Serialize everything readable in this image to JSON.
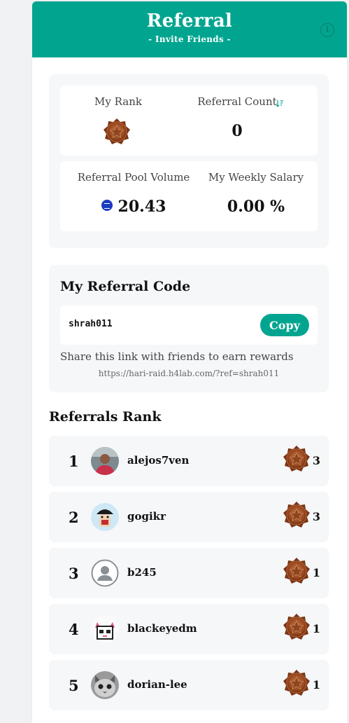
{
  "header": {
    "title": "Referral",
    "subtitle": "- Invite Friends -",
    "info_icon": "info-circle-icon",
    "color": "#01a58f"
  },
  "stats": {
    "my_rank_label": "My Rank",
    "my_rank_icon": "bronze-medal-icon",
    "referral_count_label": "Referral Count",
    "referral_count_icon": "sort-icon",
    "referral_count_value": "0",
    "pool_volume_label": "Referral Pool Volume",
    "pool_volume_icon": "steem-coin-icon",
    "pool_volume_value": "20.43",
    "weekly_salary_label": "My Weekly Salary",
    "weekly_salary_value": "0.00 %"
  },
  "referral_code": {
    "title": "My Referral Code",
    "code": "shrah011",
    "copy_label": "Copy",
    "share_text": "Share this link with friends to earn rewards",
    "share_link": "https://hari-raid.h4lab.com/?ref=shrah011"
  },
  "ranks": {
    "title": "Referrals Rank",
    "rows": [
      {
        "rank": "1",
        "name": "alejos7ven",
        "count": "3"
      },
      {
        "rank": "2",
        "name": "gogikr",
        "count": "3"
      },
      {
        "rank": "3",
        "name": "b245",
        "count": "1"
      },
      {
        "rank": "4",
        "name": "blackeyedm",
        "count": "1"
      },
      {
        "rank": "5",
        "name": "dorian-lee",
        "count": "1"
      }
    ]
  }
}
